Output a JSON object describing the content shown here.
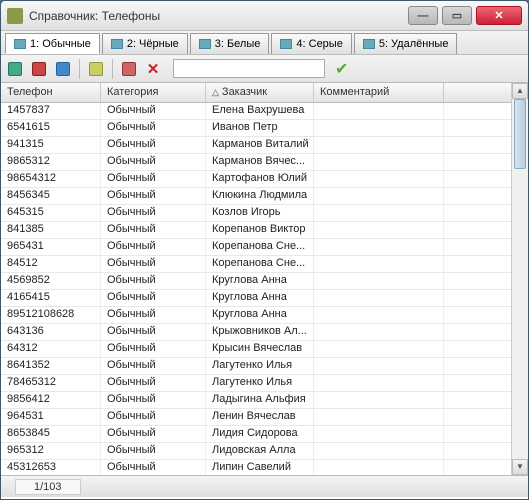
{
  "window": {
    "title": "Справочник: Телефоны"
  },
  "tabs": [
    {
      "label": "1: Обычные",
      "active": true
    },
    {
      "label": "2: Чёрные"
    },
    {
      "label": "3: Белые"
    },
    {
      "label": "4: Серые"
    },
    {
      "label": "5: Удалённые"
    }
  ],
  "search": {
    "placeholder": ""
  },
  "columns": [
    {
      "label": "Телефон"
    },
    {
      "label": "Категория"
    },
    {
      "label": "Заказчик",
      "sort": "asc"
    },
    {
      "label": "Комментарий"
    }
  ],
  "rows": [
    {
      "phone": "1457837",
      "category": "Обычный",
      "customer": "Елена Вахрушева",
      "comment": ""
    },
    {
      "phone": "6541615",
      "category": "Обычный",
      "customer": "Иванов Петр",
      "comment": ""
    },
    {
      "phone": "941315",
      "category": "Обычный",
      "customer": "Карманов Виталий",
      "comment": ""
    },
    {
      "phone": "9865312",
      "category": "Обычный",
      "customer": "Карманов Вячес...",
      "comment": ""
    },
    {
      "phone": "98654312",
      "category": "Обычный",
      "customer": "Картофанов Юлий",
      "comment": ""
    },
    {
      "phone": "8456345",
      "category": "Обычный",
      "customer": "Клюкина Людмила",
      "comment": ""
    },
    {
      "phone": "645315",
      "category": "Обычный",
      "customer": "Козлов Игорь",
      "comment": ""
    },
    {
      "phone": "841385",
      "category": "Обычный",
      "customer": "Корепанов Виктор",
      "comment": ""
    },
    {
      "phone": "965431",
      "category": "Обычный",
      "customer": "Корепанова Сне...",
      "comment": ""
    },
    {
      "phone": "84512",
      "category": "Обычный",
      "customer": "Корепанова Сне...",
      "comment": ""
    },
    {
      "phone": "4569852",
      "category": "Обычный",
      "customer": "Круглова Анна",
      "comment": ""
    },
    {
      "phone": "4165415",
      "category": "Обычный",
      "customer": "Круглова Анна",
      "comment": ""
    },
    {
      "phone": "89512108628",
      "category": "Обычный",
      "customer": "Круглова Анна",
      "comment": ""
    },
    {
      "phone": "643136",
      "category": "Обычный",
      "customer": "Крыжовников Ал...",
      "comment": ""
    },
    {
      "phone": "64312",
      "category": "Обычный",
      "customer": "Крысин Вячеслав",
      "comment": ""
    },
    {
      "phone": "8641352",
      "category": "Обычный",
      "customer": "Лагутенко Илья",
      "comment": ""
    },
    {
      "phone": "78465312",
      "category": "Обычный",
      "customer": "Лагутенко Илья",
      "comment": ""
    },
    {
      "phone": "9856412",
      "category": "Обычный",
      "customer": "Ладыгина Альфия",
      "comment": ""
    },
    {
      "phone": "964531",
      "category": "Обычный",
      "customer": "Ленин Вячеслав",
      "comment": ""
    },
    {
      "phone": "8653845",
      "category": "Обычный",
      "customer": "Лидия Сидорова",
      "comment": ""
    },
    {
      "phone": "965312",
      "category": "Обычный",
      "customer": "Лидовская Алла",
      "comment": ""
    },
    {
      "phone": "45312653",
      "category": "Обычный",
      "customer": "Липин Савелий",
      "comment": ""
    }
  ],
  "status": {
    "counter": "1/103"
  }
}
